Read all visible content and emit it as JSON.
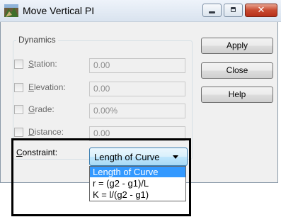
{
  "window": {
    "title": "Move Vertical PI",
    "close_symbol": "✕"
  },
  "dynamics": {
    "group_label": "Dynamics",
    "rows": [
      {
        "accel": "S",
        "rest": "tation:",
        "value": "0.00",
        "checked": false
      },
      {
        "accel": "E",
        "rest": "levation:",
        "value": "0.00",
        "checked": false
      },
      {
        "accel": "G",
        "rest": "rade:",
        "value": "0.00%",
        "checked": false
      },
      {
        "accel": "D",
        "rest": "istance:",
        "value": "0.00",
        "checked": false
      }
    ]
  },
  "buttons": {
    "apply": "Apply",
    "close": "Close",
    "help": "Help"
  },
  "constraint": {
    "label_accel": "C",
    "label_rest": "onstraint:",
    "selected": "Length of Curve",
    "options": [
      "Length of Curve",
      "r = (g2 - g1)/L",
      "K = l/(g2 - g1)"
    ]
  },
  "colors": {
    "highlight": "#3399ff",
    "callout_border": "#000000"
  }
}
